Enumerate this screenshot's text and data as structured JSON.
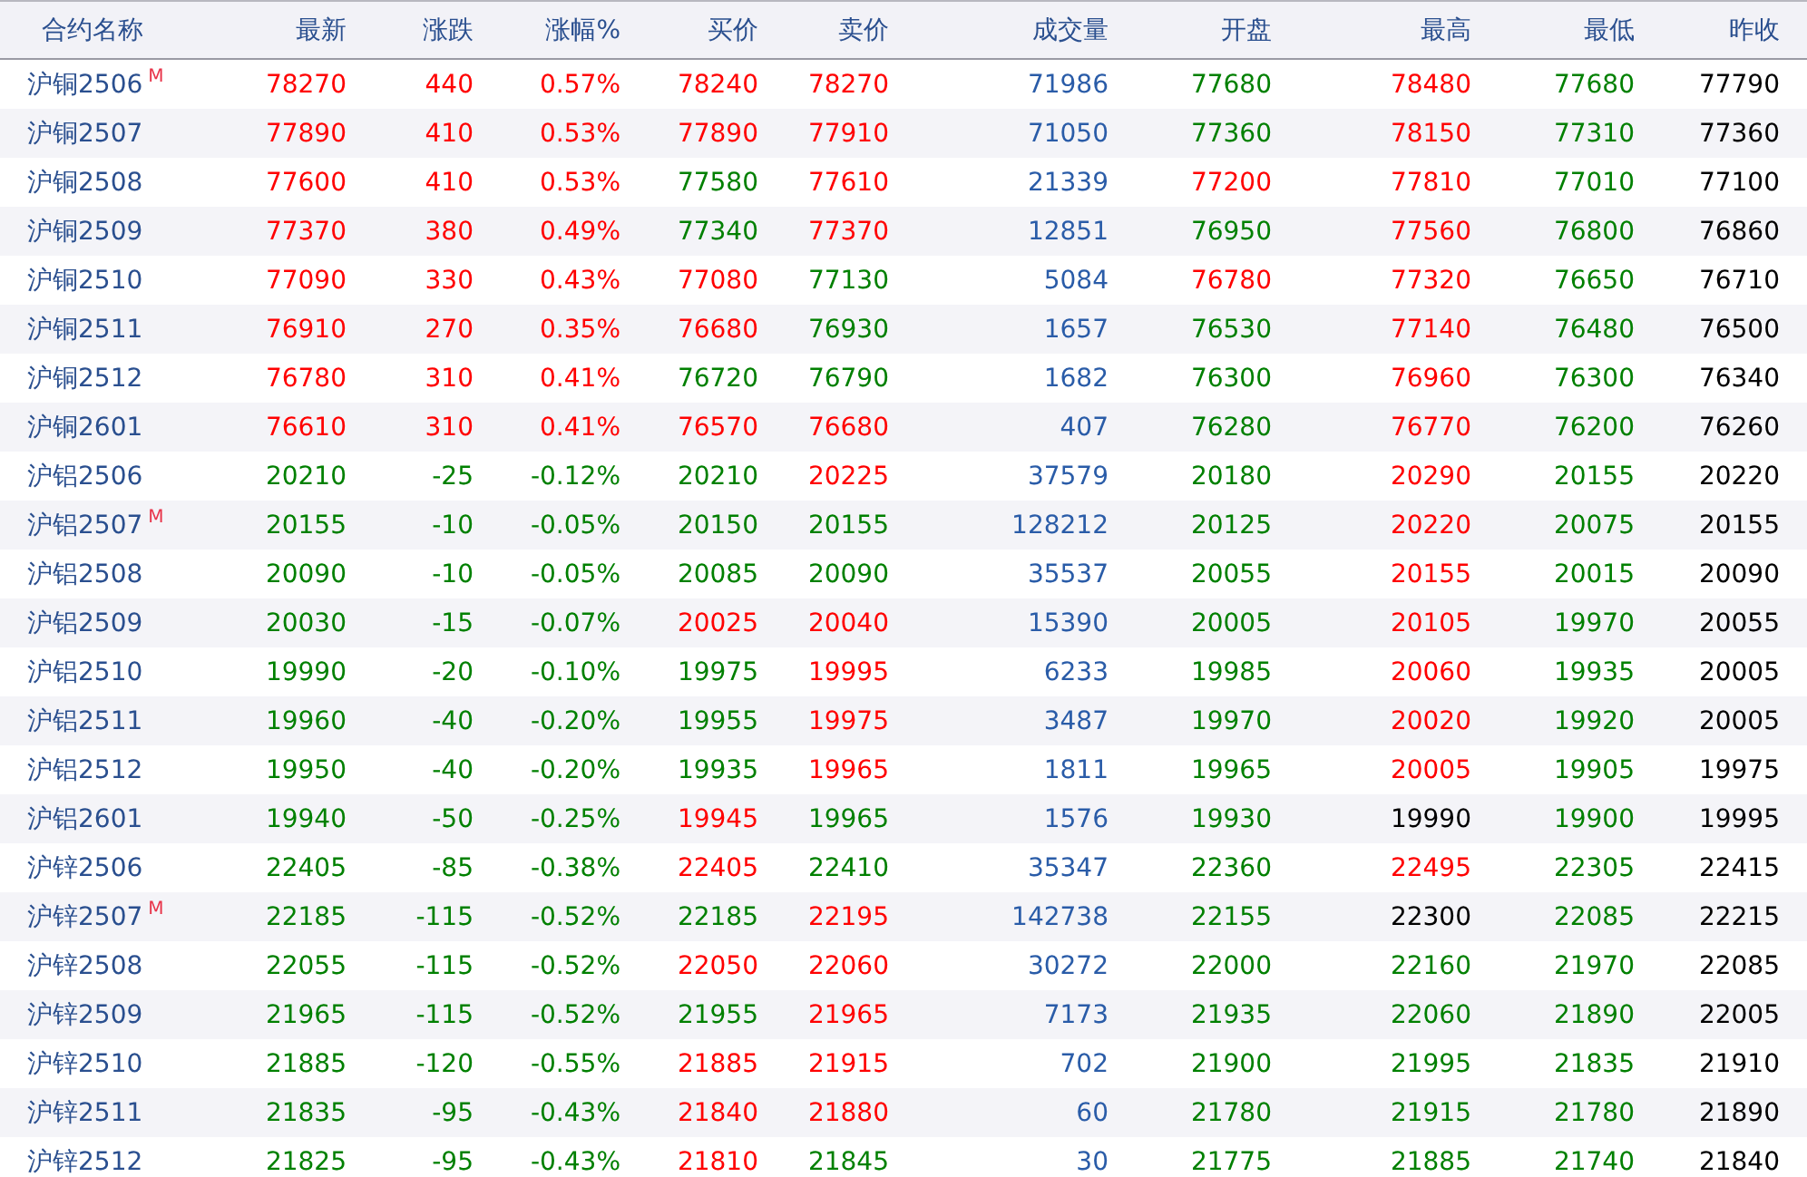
{
  "table": {
    "columns": [
      {
        "label": "合约名称",
        "kind": "name"
      },
      {
        "label": "最新",
        "kind": "price"
      },
      {
        "label": "涨跌",
        "kind": "price"
      },
      {
        "label": "涨幅%",
        "kind": "price"
      },
      {
        "label": "买价",
        "kind": "price"
      },
      {
        "label": "卖价",
        "kind": "price"
      },
      {
        "label": "成交量",
        "kind": "volume"
      },
      {
        "label": "开盘",
        "kind": "price"
      },
      {
        "label": "最高",
        "kind": "price"
      },
      {
        "label": "最低",
        "kind": "price"
      },
      {
        "label": "昨收",
        "kind": "close"
      }
    ],
    "rows": [
      {
        "cells": [
          {
            "v": "沪铜2506",
            "badge": "M"
          },
          {
            "v": "78270",
            "color": "#ff0000"
          },
          {
            "v": "440",
            "color": "#ff0000"
          },
          {
            "v": "0.57%",
            "color": "#ff0000"
          },
          {
            "v": "78240",
            "color": "#ff0000"
          },
          {
            "v": "78270",
            "color": "#ff0000"
          },
          {
            "v": "71986"
          },
          {
            "v": "77680",
            "color": "#008000"
          },
          {
            "v": "78480",
            "color": "#ff0000"
          },
          {
            "v": "77680",
            "color": "#008000"
          },
          {
            "v": "77790"
          }
        ]
      },
      {
        "cells": [
          {
            "v": "沪铜2507"
          },
          {
            "v": "77890",
            "color": "#ff0000"
          },
          {
            "v": "410",
            "color": "#ff0000"
          },
          {
            "v": "0.53%",
            "color": "#ff0000"
          },
          {
            "v": "77890",
            "color": "#ff0000"
          },
          {
            "v": "77910",
            "color": "#ff0000"
          },
          {
            "v": "71050"
          },
          {
            "v": "77360",
            "color": "#008000"
          },
          {
            "v": "78150",
            "color": "#ff0000"
          },
          {
            "v": "77310",
            "color": "#008000"
          },
          {
            "v": "77360"
          }
        ]
      },
      {
        "cells": [
          {
            "v": "沪铜2508"
          },
          {
            "v": "77600",
            "color": "#ff0000"
          },
          {
            "v": "410",
            "color": "#ff0000"
          },
          {
            "v": "0.53%",
            "color": "#ff0000"
          },
          {
            "v": "77580",
            "color": "#008000"
          },
          {
            "v": "77610",
            "color": "#ff0000"
          },
          {
            "v": "21339"
          },
          {
            "v": "77200",
            "color": "#ff0000"
          },
          {
            "v": "77810",
            "color": "#ff0000"
          },
          {
            "v": "77010",
            "color": "#008000"
          },
          {
            "v": "77100"
          }
        ]
      },
      {
        "cells": [
          {
            "v": "沪铜2509"
          },
          {
            "v": "77370",
            "color": "#ff0000"
          },
          {
            "v": "380",
            "color": "#ff0000"
          },
          {
            "v": "0.49%",
            "color": "#ff0000"
          },
          {
            "v": "77340",
            "color": "#008000"
          },
          {
            "v": "77370",
            "color": "#ff0000"
          },
          {
            "v": "12851"
          },
          {
            "v": "76950",
            "color": "#008000"
          },
          {
            "v": "77560",
            "color": "#ff0000"
          },
          {
            "v": "76800",
            "color": "#008000"
          },
          {
            "v": "76860"
          }
        ]
      },
      {
        "cells": [
          {
            "v": "沪铜2510"
          },
          {
            "v": "77090",
            "color": "#ff0000"
          },
          {
            "v": "330",
            "color": "#ff0000"
          },
          {
            "v": "0.43%",
            "color": "#ff0000"
          },
          {
            "v": "77080",
            "color": "#ff0000"
          },
          {
            "v": "77130",
            "color": "#008000"
          },
          {
            "v": "5084"
          },
          {
            "v": "76780",
            "color": "#ff0000"
          },
          {
            "v": "77320",
            "color": "#ff0000"
          },
          {
            "v": "76650",
            "color": "#008000"
          },
          {
            "v": "76710"
          }
        ]
      },
      {
        "cells": [
          {
            "v": "沪铜2511"
          },
          {
            "v": "76910",
            "color": "#ff0000"
          },
          {
            "v": "270",
            "color": "#ff0000"
          },
          {
            "v": "0.35%",
            "color": "#ff0000"
          },
          {
            "v": "76680",
            "color": "#ff0000"
          },
          {
            "v": "76930",
            "color": "#008000"
          },
          {
            "v": "1657"
          },
          {
            "v": "76530",
            "color": "#008000"
          },
          {
            "v": "77140",
            "color": "#ff0000"
          },
          {
            "v": "76480",
            "color": "#008000"
          },
          {
            "v": "76500"
          }
        ]
      },
      {
        "cells": [
          {
            "v": "沪铜2512"
          },
          {
            "v": "76780",
            "color": "#ff0000"
          },
          {
            "v": "310",
            "color": "#ff0000"
          },
          {
            "v": "0.41%",
            "color": "#ff0000"
          },
          {
            "v": "76720",
            "color": "#008000"
          },
          {
            "v": "76790",
            "color": "#008000"
          },
          {
            "v": "1682"
          },
          {
            "v": "76300",
            "color": "#008000"
          },
          {
            "v": "76960",
            "color": "#ff0000"
          },
          {
            "v": "76300",
            "color": "#008000"
          },
          {
            "v": "76340"
          }
        ]
      },
      {
        "cells": [
          {
            "v": "沪铜2601"
          },
          {
            "v": "76610",
            "color": "#ff0000"
          },
          {
            "v": "310",
            "color": "#ff0000"
          },
          {
            "v": "0.41%",
            "color": "#ff0000"
          },
          {
            "v": "76570",
            "color": "#ff0000"
          },
          {
            "v": "76680",
            "color": "#ff0000"
          },
          {
            "v": "407"
          },
          {
            "v": "76280",
            "color": "#008000"
          },
          {
            "v": "76770",
            "color": "#ff0000"
          },
          {
            "v": "76200",
            "color": "#008000"
          },
          {
            "v": "76260"
          }
        ]
      },
      {
        "cells": [
          {
            "v": "沪铝2506"
          },
          {
            "v": "20210",
            "color": "#008000"
          },
          {
            "v": "-25",
            "color": "#008000"
          },
          {
            "v": "-0.12%",
            "color": "#008000"
          },
          {
            "v": "20210",
            "color": "#008000"
          },
          {
            "v": "20225",
            "color": "#ff0000"
          },
          {
            "v": "37579"
          },
          {
            "v": "20180",
            "color": "#008000"
          },
          {
            "v": "20290",
            "color": "#ff0000"
          },
          {
            "v": "20155",
            "color": "#008000"
          },
          {
            "v": "20220"
          }
        ]
      },
      {
        "cells": [
          {
            "v": "沪铝2507",
            "badge": "M"
          },
          {
            "v": "20155",
            "color": "#008000"
          },
          {
            "v": "-10",
            "color": "#008000"
          },
          {
            "v": "-0.05%",
            "color": "#008000"
          },
          {
            "v": "20150",
            "color": "#008000"
          },
          {
            "v": "20155",
            "color": "#008000"
          },
          {
            "v": "128212"
          },
          {
            "v": "20125",
            "color": "#008000"
          },
          {
            "v": "20220",
            "color": "#ff0000"
          },
          {
            "v": "20075",
            "color": "#008000"
          },
          {
            "v": "20155"
          }
        ]
      },
      {
        "cells": [
          {
            "v": "沪铝2508"
          },
          {
            "v": "20090",
            "color": "#008000"
          },
          {
            "v": "-10",
            "color": "#008000"
          },
          {
            "v": "-0.05%",
            "color": "#008000"
          },
          {
            "v": "20085",
            "color": "#008000"
          },
          {
            "v": "20090",
            "color": "#008000"
          },
          {
            "v": "35537"
          },
          {
            "v": "20055",
            "color": "#008000"
          },
          {
            "v": "20155",
            "color": "#ff0000"
          },
          {
            "v": "20015",
            "color": "#008000"
          },
          {
            "v": "20090"
          }
        ]
      },
      {
        "cells": [
          {
            "v": "沪铝2509"
          },
          {
            "v": "20030",
            "color": "#008000"
          },
          {
            "v": "-15",
            "color": "#008000"
          },
          {
            "v": "-0.07%",
            "color": "#008000"
          },
          {
            "v": "20025",
            "color": "#ff0000"
          },
          {
            "v": "20040",
            "color": "#ff0000"
          },
          {
            "v": "15390"
          },
          {
            "v": "20005",
            "color": "#008000"
          },
          {
            "v": "20105",
            "color": "#ff0000"
          },
          {
            "v": "19970",
            "color": "#008000"
          },
          {
            "v": "20055"
          }
        ]
      },
      {
        "cells": [
          {
            "v": "沪铝2510"
          },
          {
            "v": "19990",
            "color": "#008000"
          },
          {
            "v": "-20",
            "color": "#008000"
          },
          {
            "v": "-0.10%",
            "color": "#008000"
          },
          {
            "v": "19975",
            "color": "#008000"
          },
          {
            "v": "19995",
            "color": "#ff0000"
          },
          {
            "v": "6233"
          },
          {
            "v": "19985",
            "color": "#008000"
          },
          {
            "v": "20060",
            "color": "#ff0000"
          },
          {
            "v": "19935",
            "color": "#008000"
          },
          {
            "v": "20005"
          }
        ]
      },
      {
        "cells": [
          {
            "v": "沪铝2511"
          },
          {
            "v": "19960",
            "color": "#008000"
          },
          {
            "v": "-40",
            "color": "#008000"
          },
          {
            "v": "-0.20%",
            "color": "#008000"
          },
          {
            "v": "19955",
            "color": "#008000"
          },
          {
            "v": "19975",
            "color": "#ff0000"
          },
          {
            "v": "3487"
          },
          {
            "v": "19970",
            "color": "#008000"
          },
          {
            "v": "20020",
            "color": "#ff0000"
          },
          {
            "v": "19920",
            "color": "#008000"
          },
          {
            "v": "20005"
          }
        ]
      },
      {
        "cells": [
          {
            "v": "沪铝2512"
          },
          {
            "v": "19950",
            "color": "#008000"
          },
          {
            "v": "-40",
            "color": "#008000"
          },
          {
            "v": "-0.20%",
            "color": "#008000"
          },
          {
            "v": "19935",
            "color": "#008000"
          },
          {
            "v": "19965",
            "color": "#ff0000"
          },
          {
            "v": "1811"
          },
          {
            "v": "19965",
            "color": "#008000"
          },
          {
            "v": "20005",
            "color": "#ff0000"
          },
          {
            "v": "19905",
            "color": "#008000"
          },
          {
            "v": "19975"
          }
        ]
      },
      {
        "cells": [
          {
            "v": "沪铝2601"
          },
          {
            "v": "19940",
            "color": "#008000"
          },
          {
            "v": "-50",
            "color": "#008000"
          },
          {
            "v": "-0.25%",
            "color": "#008000"
          },
          {
            "v": "19945",
            "color": "#ff0000"
          },
          {
            "v": "19965",
            "color": "#008000"
          },
          {
            "v": "1576"
          },
          {
            "v": "19930",
            "color": "#008000"
          },
          {
            "v": "19990",
            "color": "#000000"
          },
          {
            "v": "19900",
            "color": "#008000"
          },
          {
            "v": "19995"
          }
        ]
      },
      {
        "cells": [
          {
            "v": "沪锌2506"
          },
          {
            "v": "22405",
            "color": "#008000"
          },
          {
            "v": "-85",
            "color": "#008000"
          },
          {
            "v": "-0.38%",
            "color": "#008000"
          },
          {
            "v": "22405",
            "color": "#ff0000"
          },
          {
            "v": "22410",
            "color": "#008000"
          },
          {
            "v": "35347"
          },
          {
            "v": "22360",
            "color": "#008000"
          },
          {
            "v": "22495",
            "color": "#ff0000"
          },
          {
            "v": "22305",
            "color": "#008000"
          },
          {
            "v": "22415"
          }
        ]
      },
      {
        "cells": [
          {
            "v": "沪锌2507",
            "badge": "M"
          },
          {
            "v": "22185",
            "color": "#008000"
          },
          {
            "v": "-115",
            "color": "#008000"
          },
          {
            "v": "-0.52%",
            "color": "#008000"
          },
          {
            "v": "22185",
            "color": "#008000"
          },
          {
            "v": "22195",
            "color": "#ff0000"
          },
          {
            "v": "142738"
          },
          {
            "v": "22155",
            "color": "#008000"
          },
          {
            "v": "22300",
            "color": "#000000"
          },
          {
            "v": "22085",
            "color": "#008000"
          },
          {
            "v": "22215"
          }
        ]
      },
      {
        "cells": [
          {
            "v": "沪锌2508"
          },
          {
            "v": "22055",
            "color": "#008000"
          },
          {
            "v": "-115",
            "color": "#008000"
          },
          {
            "v": "-0.52%",
            "color": "#008000"
          },
          {
            "v": "22050",
            "color": "#ff0000"
          },
          {
            "v": "22060",
            "color": "#ff0000"
          },
          {
            "v": "30272"
          },
          {
            "v": "22000",
            "color": "#008000"
          },
          {
            "v": "22160",
            "color": "#008000"
          },
          {
            "v": "21970",
            "color": "#008000"
          },
          {
            "v": "22085"
          }
        ]
      },
      {
        "cells": [
          {
            "v": "沪锌2509"
          },
          {
            "v": "21965",
            "color": "#008000"
          },
          {
            "v": "-115",
            "color": "#008000"
          },
          {
            "v": "-0.52%",
            "color": "#008000"
          },
          {
            "v": "21955",
            "color": "#008000"
          },
          {
            "v": "21965",
            "color": "#ff0000"
          },
          {
            "v": "7173"
          },
          {
            "v": "21935",
            "color": "#008000"
          },
          {
            "v": "22060",
            "color": "#008000"
          },
          {
            "v": "21890",
            "color": "#008000"
          },
          {
            "v": "22005"
          }
        ]
      },
      {
        "cells": [
          {
            "v": "沪锌2510"
          },
          {
            "v": "21885",
            "color": "#008000"
          },
          {
            "v": "-120",
            "color": "#008000"
          },
          {
            "v": "-0.55%",
            "color": "#008000"
          },
          {
            "v": "21885",
            "color": "#ff0000"
          },
          {
            "v": "21915",
            "color": "#ff0000"
          },
          {
            "v": "702"
          },
          {
            "v": "21900",
            "color": "#008000"
          },
          {
            "v": "21995",
            "color": "#008000"
          },
          {
            "v": "21835",
            "color": "#008000"
          },
          {
            "v": "21910"
          }
        ]
      },
      {
        "cells": [
          {
            "v": "沪锌2511"
          },
          {
            "v": "21835",
            "color": "#008000"
          },
          {
            "v": "-95",
            "color": "#008000"
          },
          {
            "v": "-0.43%",
            "color": "#008000"
          },
          {
            "v": "21840",
            "color": "#ff0000"
          },
          {
            "v": "21880",
            "color": "#ff0000"
          },
          {
            "v": "60"
          },
          {
            "v": "21780",
            "color": "#008000"
          },
          {
            "v": "21915",
            "color": "#008000"
          },
          {
            "v": "21780",
            "color": "#008000"
          },
          {
            "v": "21890"
          }
        ]
      },
      {
        "cells": [
          {
            "v": "沪锌2512"
          },
          {
            "v": "21825",
            "color": "#008000"
          },
          {
            "v": "-95",
            "color": "#008000"
          },
          {
            "v": "-0.43%",
            "color": "#008000"
          },
          {
            "v": "21810",
            "color": "#ff0000"
          },
          {
            "v": "21845",
            "color": "#008000"
          },
          {
            "v": "30"
          },
          {
            "v": "21775",
            "color": "#008000"
          },
          {
            "v": "21885",
            "color": "#008000"
          },
          {
            "v": "21740",
            "color": "#008000"
          },
          {
            "v": "21840"
          }
        ]
      }
    ]
  }
}
